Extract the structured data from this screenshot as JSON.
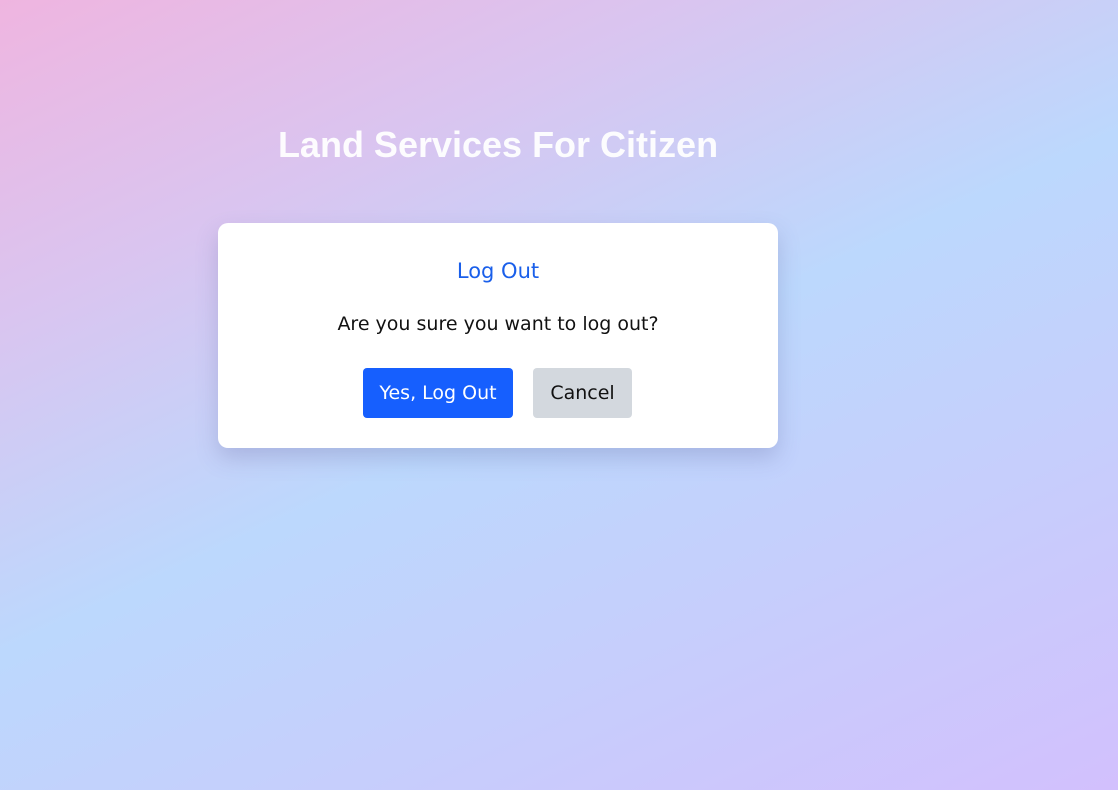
{
  "page": {
    "title": "Land Services For Citizen"
  },
  "dialog": {
    "title": "Log Out",
    "message": "Are you sure you want to log out?",
    "confirm_label": "Yes, Log Out",
    "cancel_label": "Cancel"
  },
  "colors": {
    "accent": "#1a5fea",
    "confirm_button": "#165ffe",
    "cancel_button": "#d3d8de",
    "title_text": "#ffffff"
  }
}
